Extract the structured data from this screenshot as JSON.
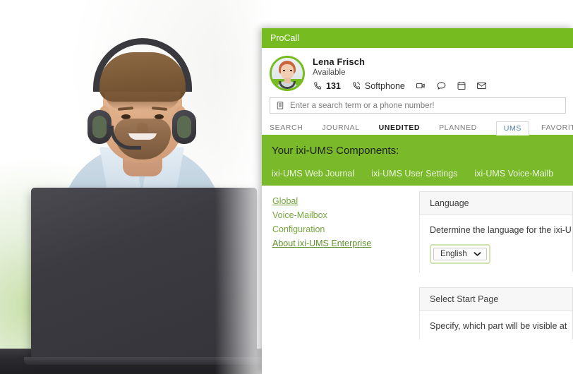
{
  "window": {
    "title": "ProCall"
  },
  "profile": {
    "name": "Lena Frisch",
    "status": "Available",
    "extension": "131",
    "softphone_label": "Softphone",
    "avatar_alt": "avatar",
    "actions": [
      {
        "icon": "phone-icon"
      },
      {
        "icon": "headset-phone-icon"
      },
      {
        "icon": "video-camera-icon"
      },
      {
        "icon": "chat-bubble-icon"
      },
      {
        "icon": "calendar-icon"
      },
      {
        "icon": "envelope-icon"
      }
    ]
  },
  "search": {
    "placeholder": "Enter a search term or a phone number!",
    "value": "",
    "icon": "contact-card-icon"
  },
  "tabs": [
    {
      "label": "SEARCH",
      "state": "normal"
    },
    {
      "label": "JOURNAL",
      "state": "normal"
    },
    {
      "label": "UNEDITED",
      "state": "bold"
    },
    {
      "label": "PLANNED",
      "state": "normal"
    },
    {
      "label": "UMS",
      "state": "active"
    },
    {
      "label": "FAVORITES",
      "state": "normal"
    }
  ],
  "banner": {
    "heading": "Your ixi-UMS Components:",
    "components": [
      "ixi-UMS Web Journal",
      "ixi-UMS User Settings",
      "ixi-UMS Voice-Mailb"
    ]
  },
  "sidenav": {
    "items": [
      {
        "label": "Global",
        "underline": true
      },
      {
        "label": "Voice-Mailbox",
        "underline": false
      },
      {
        "label": "Configuration",
        "underline": false
      },
      {
        "label": "About ixi-UMS Enterprise",
        "underline": true
      }
    ]
  },
  "cards": [
    {
      "title": "Language",
      "description": "Determine the language for the ixi-U",
      "select": {
        "value": "English",
        "chevron": "chevron-down-icon"
      }
    },
    {
      "title": "Select Start Page",
      "description": "Specify, which part will be visible at"
    }
  ],
  "colors": {
    "brand_green": "#76bc21",
    "banner_green": "#7ab929",
    "link_green": "#76a63c",
    "active_tab_text": "#4c7fa3"
  }
}
